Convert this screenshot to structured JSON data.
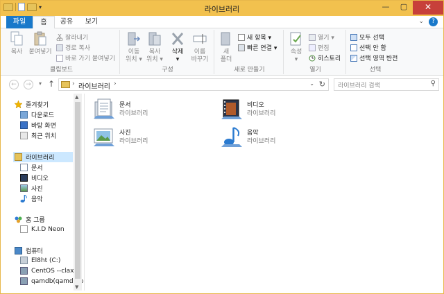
{
  "window": {
    "title": "라이브러리"
  },
  "tabs": {
    "file": "파일",
    "home": "홈",
    "share": "공유",
    "view": "보기"
  },
  "help": "?",
  "ribbon": {
    "clipboard": {
      "label": "클립보드",
      "copy": "복사",
      "paste": "붙여넣기",
      "cut": "잘라내기",
      "copy_path": "경로 복사",
      "paste_shortcut": "바로 가기 붙여넣기"
    },
    "organize": {
      "label": "구성",
      "move_to": [
        "이동",
        "위치 ▾"
      ],
      "copy_to": [
        "복사",
        "위치 ▾"
      ],
      "delete": [
        "삭제",
        "▾"
      ],
      "rename": [
        "이름",
        "바꾸기"
      ]
    },
    "new": {
      "label": "새로 만들기",
      "new_folder": [
        "새",
        "폴더"
      ],
      "new_item": "새 항목 ▾",
      "easy_access": "빠른 연결 ▾"
    },
    "open": {
      "label": "열기",
      "properties": [
        "속성",
        "▾"
      ],
      "open": "열기 ▾",
      "edit": "편집",
      "history": "히스토리"
    },
    "select": {
      "label": "선택",
      "select_all": "모두 선택",
      "select_none": "선택 안 함",
      "invert": "선택 영역 반전"
    }
  },
  "address": {
    "path": "라이브러리",
    "search_placeholder": "라이브러리 검색"
  },
  "nav": {
    "favorites": "즐겨찾기",
    "downloads": "다운로드",
    "desktop": "바탕 화면",
    "recent": "최근 위치",
    "libraries": "라이브러리",
    "documents": "문서",
    "videos": "비디오",
    "pictures": "사진",
    "music": "음악",
    "homegroup": "홈 그룹",
    "hg_user": "K.I.D Neon",
    "computer": "컴퓨터",
    "drive_c": "El8ht (C:)",
    "centos": "CentOS --clax",
    "qamdb": "qamdb(qamdb-p"
  },
  "libraries": [
    {
      "name": "문서",
      "sub": "라이브러리"
    },
    {
      "name": "비디오",
      "sub": "라이브러리"
    },
    {
      "name": "사진",
      "sub": "라이브러리"
    },
    {
      "name": "음악",
      "sub": "라이브러리"
    }
  ]
}
